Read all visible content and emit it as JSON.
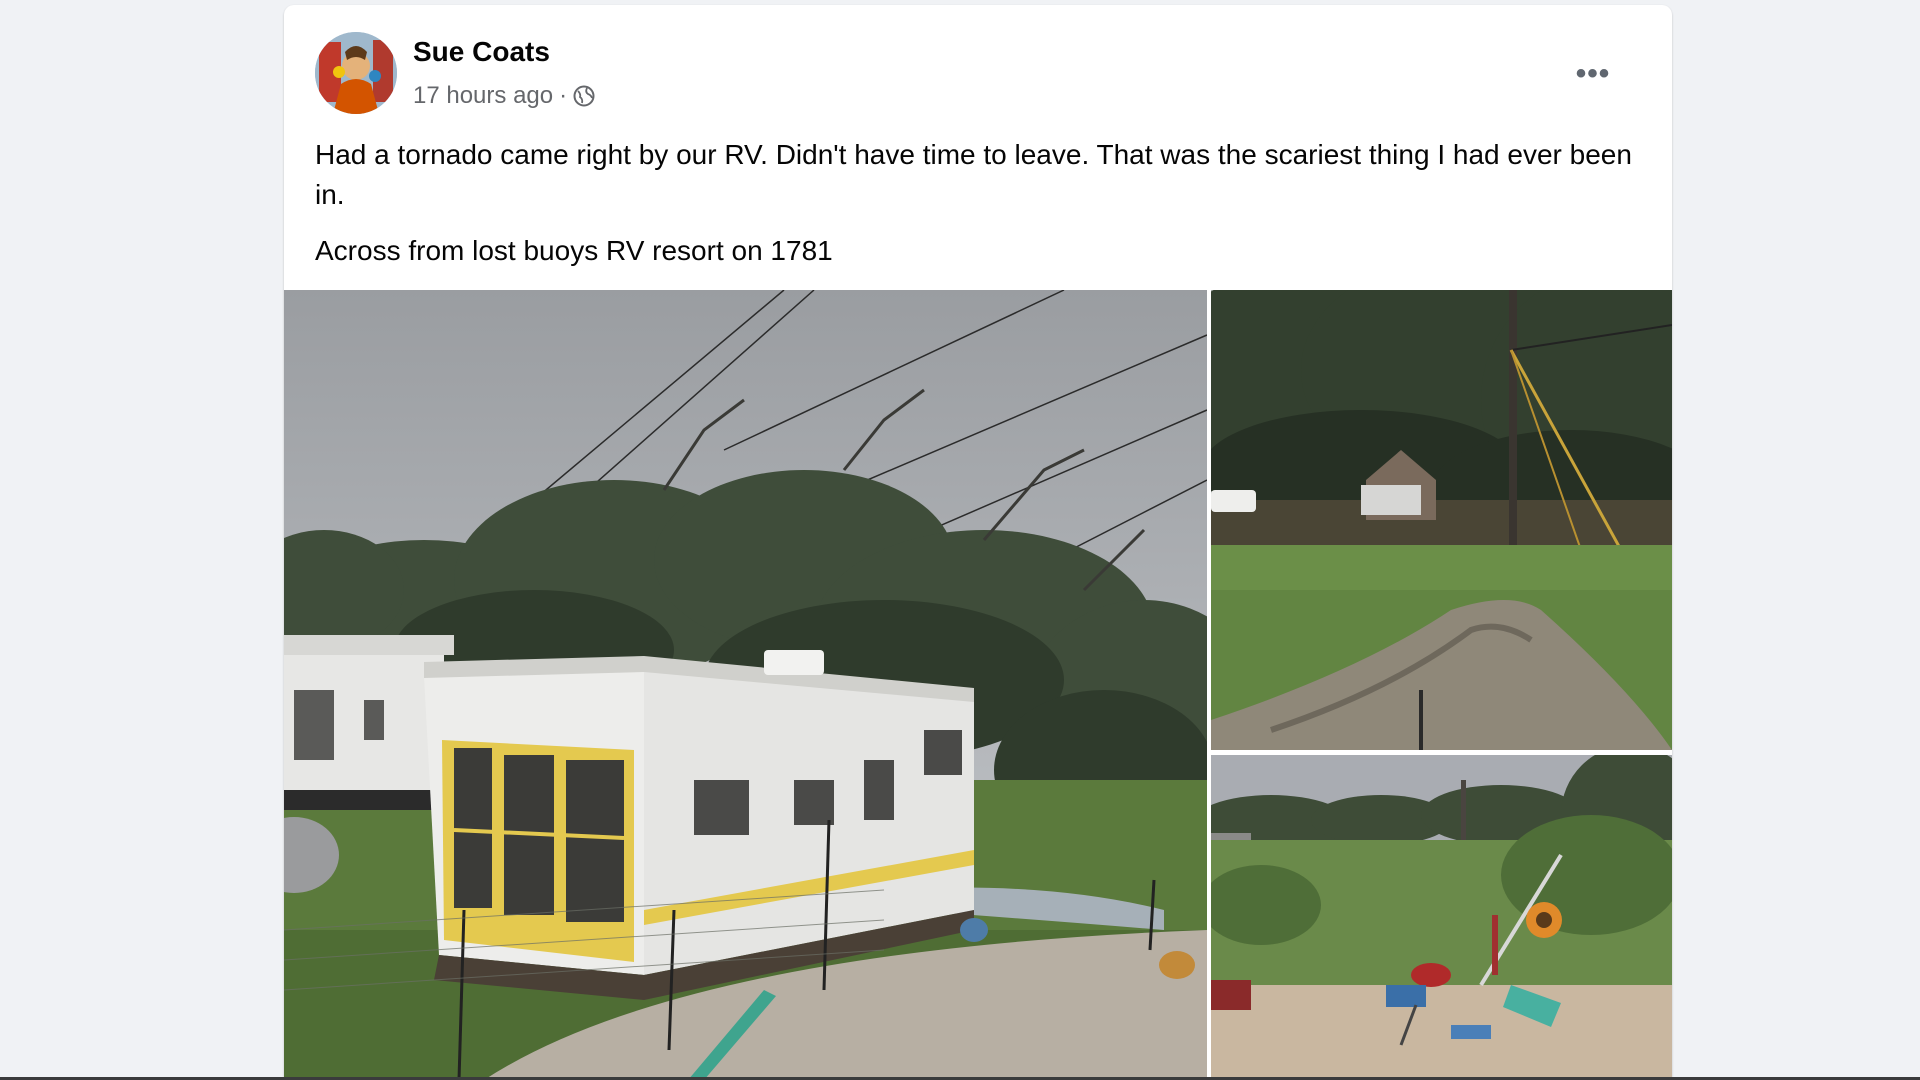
{
  "post": {
    "author": "Sue Coats",
    "timestamp": "17 hours ago",
    "separator": "·",
    "audience_icon": "globe-icon",
    "more_icon": "more-options-icon",
    "text_lines": [
      "Had a tornado came right by our RV. Didn't have time to leave. That was the scariest thing I had ever been in.",
      "Across from lost buoys RV resort on 1781"
    ],
    "photos": [
      {
        "depicts": "damaged-mobile-home-with-fallen-tree"
      },
      {
        "depicts": "fallen-trees-and-muddy-path"
      },
      {
        "depicts": "scattered-debris-in-field"
      }
    ]
  },
  "colors": {
    "page_background": "#f0f2f5",
    "card_background": "#ffffff",
    "name_text": "#050505",
    "meta_text": "#65676b"
  }
}
